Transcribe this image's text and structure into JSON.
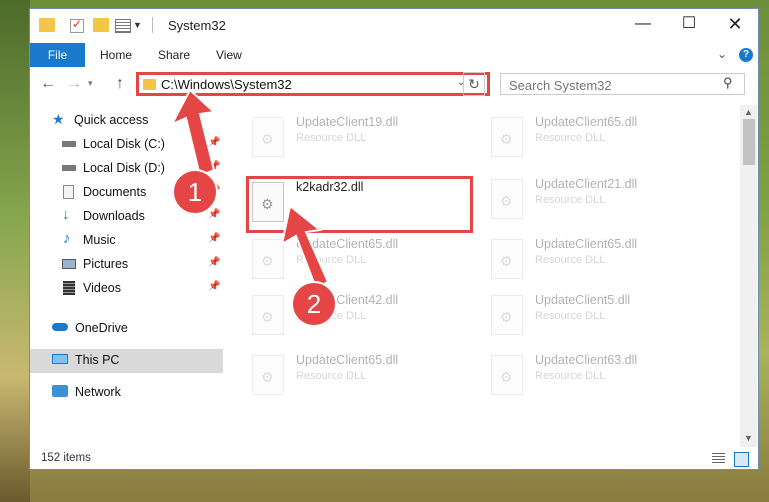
{
  "window": {
    "title": "System32"
  },
  "titlebar": {
    "min": "—",
    "max": "☐",
    "close": "✕"
  },
  "ribbon": {
    "tabs": [
      "File",
      "Home",
      "Share",
      "View"
    ],
    "help": "?"
  },
  "navigation": {
    "address": "C:\\Windows\\System32",
    "search_placeholder": "Search System32"
  },
  "sidebar": {
    "items": [
      {
        "label": "Quick access",
        "icon": "star-icon",
        "pinned": false
      },
      {
        "label": "Local Disk (C:)",
        "icon": "drive-icon",
        "pinned": true
      },
      {
        "label": "Local Disk (D:)",
        "icon": "drive-icon",
        "pinned": true
      },
      {
        "label": "Documents",
        "icon": "documents-icon",
        "pinned": true
      },
      {
        "label": "Downloads",
        "icon": "download-icon",
        "pinned": true
      },
      {
        "label": "Music",
        "icon": "music-icon",
        "pinned": true
      },
      {
        "label": "Pictures",
        "icon": "pictures-icon",
        "pinned": true
      },
      {
        "label": "Videos",
        "icon": "videos-icon",
        "pinned": true
      },
      {
        "label": "OneDrive",
        "icon": "cloud-icon",
        "pinned": false
      },
      {
        "label": "This PC",
        "icon": "computer-icon",
        "pinned": false,
        "selected": true
      },
      {
        "label": "Network",
        "icon": "network-icon",
        "pinned": false
      }
    ]
  },
  "files": {
    "left": [
      {
        "name": "UpdateClient19.dll",
        "type": "Resource DLL"
      },
      {
        "name": "k2kadr32.dll",
        "type": ""
      },
      {
        "name": "UpdateClient65.dll",
        "type": "Resource DLL"
      },
      {
        "name": "UpdateClient42.dll",
        "type": "Resource DLL"
      },
      {
        "name": "UpdateClient65.dll",
        "type": "Resource DLL"
      }
    ],
    "right": [
      {
        "name": "UpdateClient65.dll",
        "type": "Resource DLL"
      },
      {
        "name": "UpdateClient21.dll",
        "type": "Resource DLL"
      },
      {
        "name": "UpdateClient65.dll",
        "type": "Resource DLL"
      },
      {
        "name": "UpdateClient5.dll",
        "type": "Resource DLL"
      },
      {
        "name": "UpdateClient63.dll",
        "type": "Resource DLL"
      }
    ]
  },
  "status": {
    "items": "152 items"
  },
  "annotations": {
    "step1": "1",
    "step2": "2",
    "color": "#e64545"
  }
}
